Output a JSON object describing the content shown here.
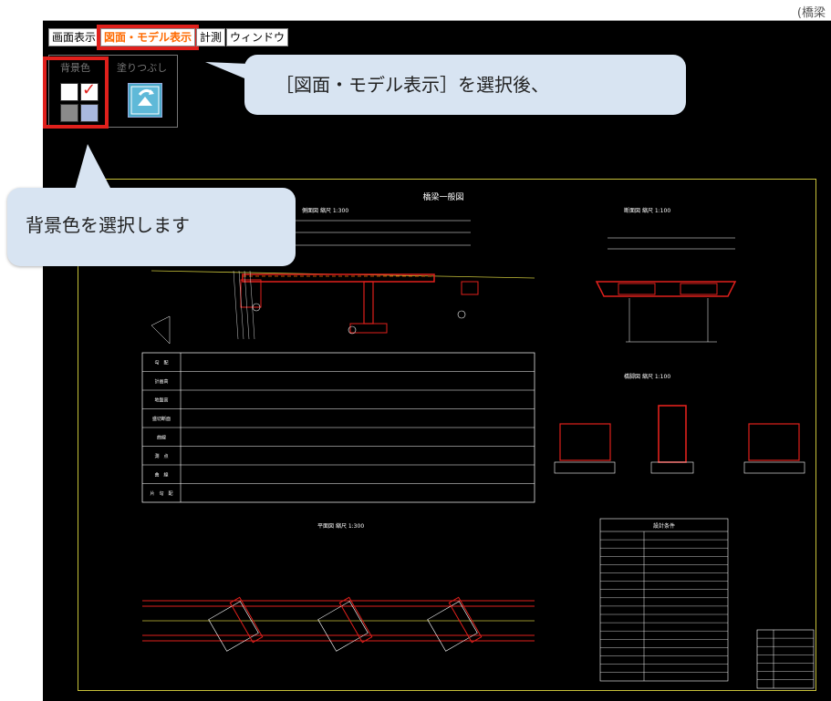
{
  "window": {
    "title_fragment": "(橋梁"
  },
  "tabs": [
    {
      "label": "画面表示",
      "active": false
    },
    {
      "label": "図面・モデル表示",
      "active": true
    },
    {
      "label": "計測",
      "active": false
    },
    {
      "label": "ウィンドウ",
      "active": false
    }
  ],
  "ribbon": {
    "bg_group_label": "背景色",
    "fill_group_label": "塗りつぶし",
    "swatch_colors": [
      "#ffffff",
      "#ffffff",
      "#8a8a8a",
      "#a9b8de"
    ],
    "checkmark": "✓"
  },
  "callouts": {
    "top": "［図面・モデル表示］を選択後、",
    "left": "背景色を選択します"
  },
  "drawing": {
    "title": "橋梁一般図",
    "views": {
      "side": "側面図",
      "side_scale": "縮尺 1:300",
      "section": "断面図",
      "section_scale": "縮尺 1:100",
      "pier": "橋脚図",
      "pier_scale": "縮尺 1:100",
      "plan": "平面図",
      "plan_scale": "縮尺 1:300"
    },
    "table_rows": [
      "勾　配",
      "計画高",
      "地盤高",
      "盛切断面",
      "曲線",
      "測　点",
      "曲　線",
      "片　勾　配"
    ],
    "spec_title": "設計条件",
    "colors": {
      "bg": "#000000",
      "line": "#ffffff",
      "member": "#e0201c",
      "frame": "#c8c23a",
      "accent": "#ff6a00"
    }
  }
}
